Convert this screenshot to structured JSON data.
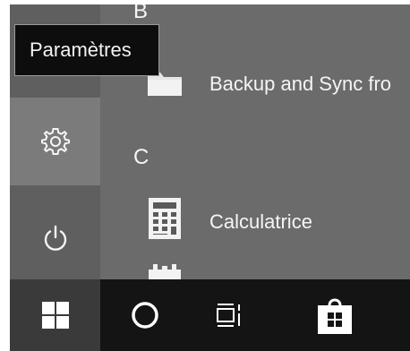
{
  "tooltip": {
    "text": "Paramètres"
  },
  "app_list": {
    "sections": [
      {
        "letter": "B"
      },
      {
        "letter": "C"
      }
    ],
    "apps": [
      {
        "name": "Backup and Sync fro",
        "icon": "folder-icon"
      },
      {
        "name": "Calculatrice",
        "icon": "calculator-icon"
      },
      {
        "name": "",
        "icon": "calendar-icon"
      }
    ]
  },
  "rail": {
    "settings": {
      "icon": "gear-icon"
    },
    "power": {
      "icon": "power-icon"
    }
  },
  "taskbar": {
    "items": [
      {
        "icon": "windows-logo-icon"
      },
      {
        "icon": "cortana-circle-icon"
      },
      {
        "icon": "task-view-icon"
      },
      {
        "icon": "store-bag-icon"
      }
    ]
  },
  "colors": {
    "panel_bg": "#6b6b6b",
    "rail_bg": "#5f5f5f",
    "hover_bg": "#7b7b7b",
    "taskbar_bg": "#141414",
    "tooltip_bg": "#0d0d0d",
    "text": "#f5f5f5"
  }
}
